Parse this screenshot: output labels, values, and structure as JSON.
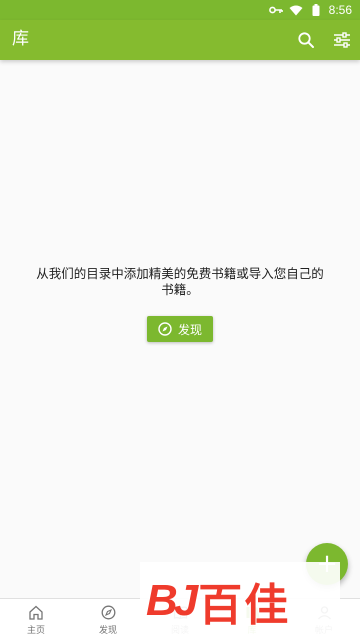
{
  "status_bar": {
    "time": "8:56",
    "icons": [
      "key-icon",
      "wifi-icon",
      "battery-icon"
    ]
  },
  "app_bar": {
    "title": "库",
    "actions": [
      "search-icon",
      "filter-settings-icon"
    ]
  },
  "empty_state": {
    "message": "从我们的目录中添加精美的免费书籍或导入您自己的书籍。",
    "button_label": "发现",
    "button_icon": "compass-icon"
  },
  "fab": {
    "label": "+"
  },
  "bottom_nav": {
    "items": [
      {
        "label": "主页",
        "icon": "home-icon"
      },
      {
        "label": "发现",
        "icon": "compass-icon"
      },
      {
        "label": "阅读",
        "icon": "book-icon"
      },
      {
        "label": "库",
        "icon": "library-icon"
      },
      {
        "label": "帐户",
        "icon": "account-icon"
      }
    ]
  },
  "watermark": {
    "logo": "BJ",
    "text": "百佳"
  },
  "colors": {
    "primary": "#85bb2f",
    "status_bar": "#7cb82f",
    "accent": "#7cb82f",
    "watermark": "#ef3b2c",
    "background": "#fafafa"
  }
}
